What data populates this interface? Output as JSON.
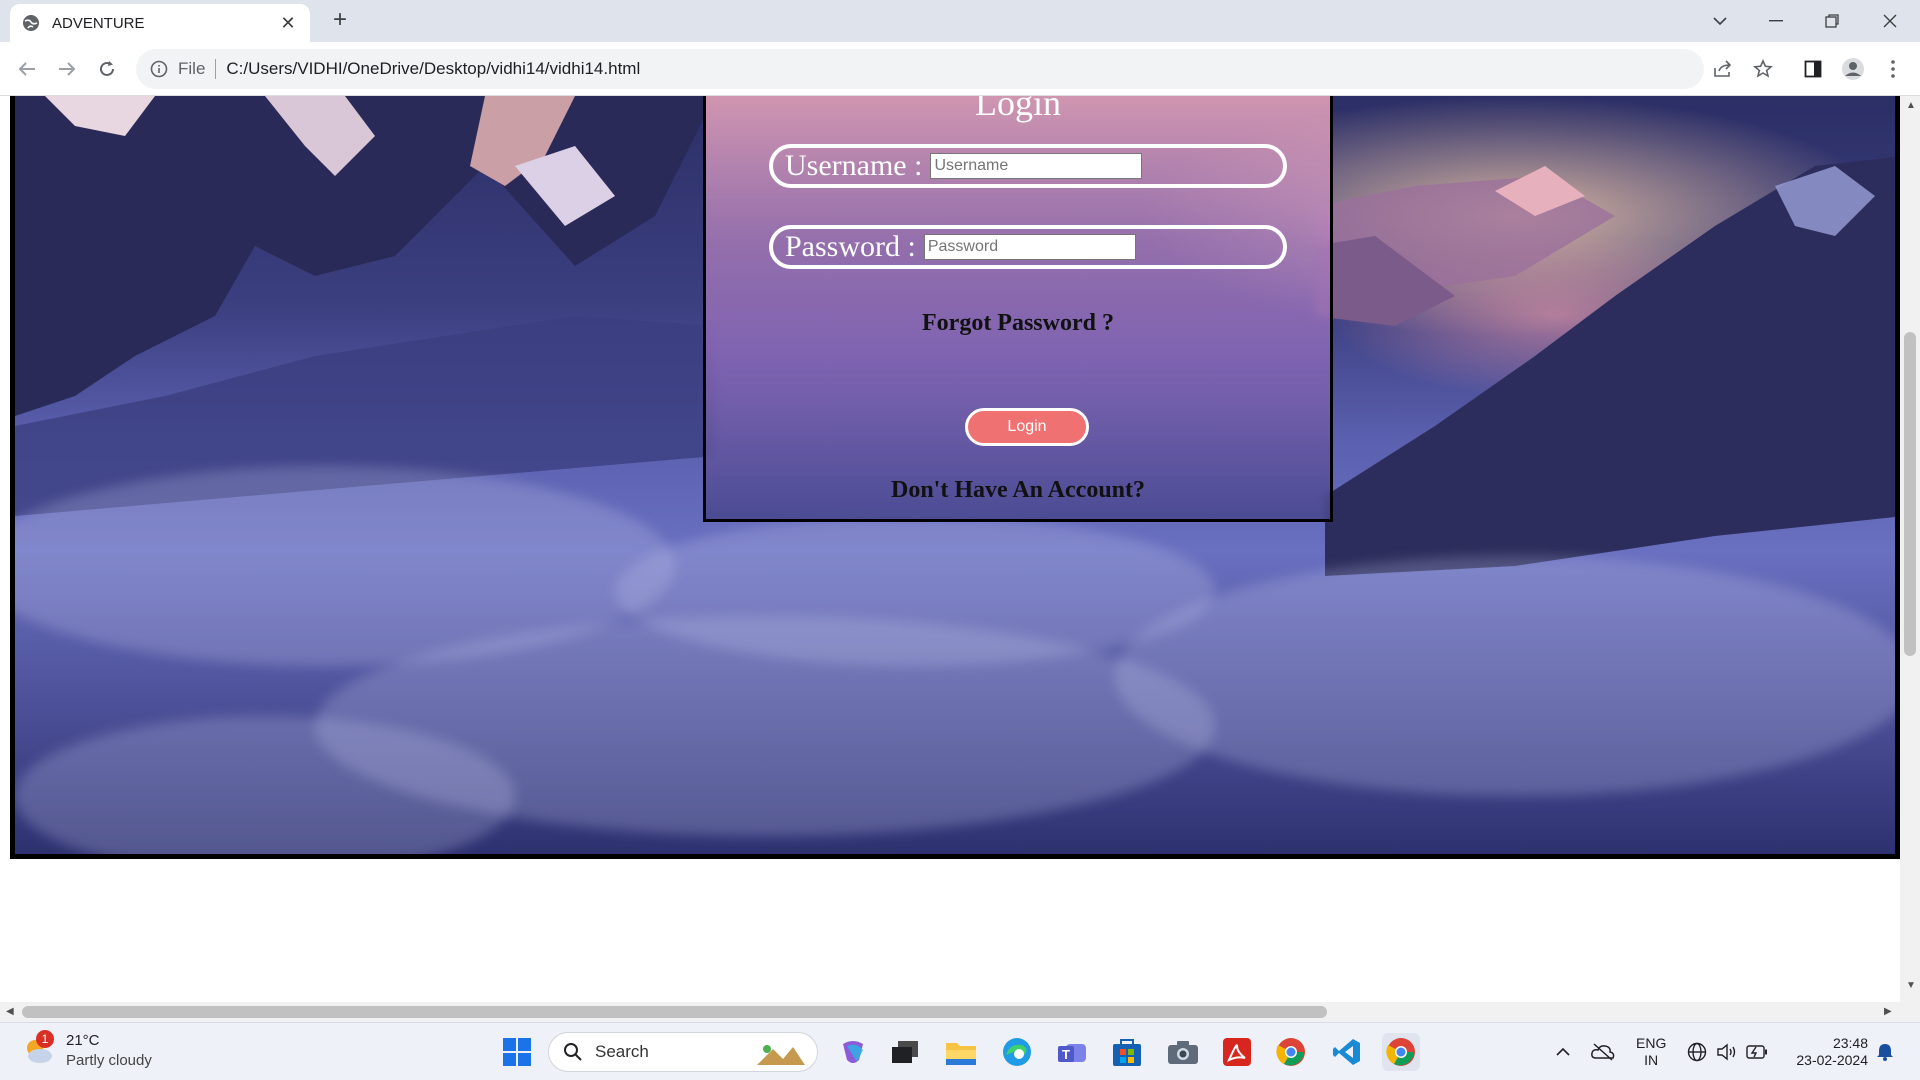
{
  "browser": {
    "tab_title": "ADVENTURE",
    "file_label": "File",
    "url": "C:/Users/VIDHI/OneDrive/Desktop/vidhi14/vidhi14.html"
  },
  "login": {
    "title": "Login",
    "username_label": "Username :",
    "username_placeholder": "Username",
    "password_label": "Password :",
    "password_placeholder": "Password",
    "forgot": "Forgot Password ?",
    "button": "Login",
    "no_account": "Don't Have An Account?"
  },
  "taskbar": {
    "weather_badge": "1",
    "temperature": "21°C",
    "condition": "Partly cloudy",
    "search": "Search",
    "lang": "ENG",
    "region": "IN",
    "time": "23:48",
    "date": "23-02-2024"
  },
  "colors": {
    "login_button": "#f07171",
    "accent_blue": "#1a73e8"
  }
}
